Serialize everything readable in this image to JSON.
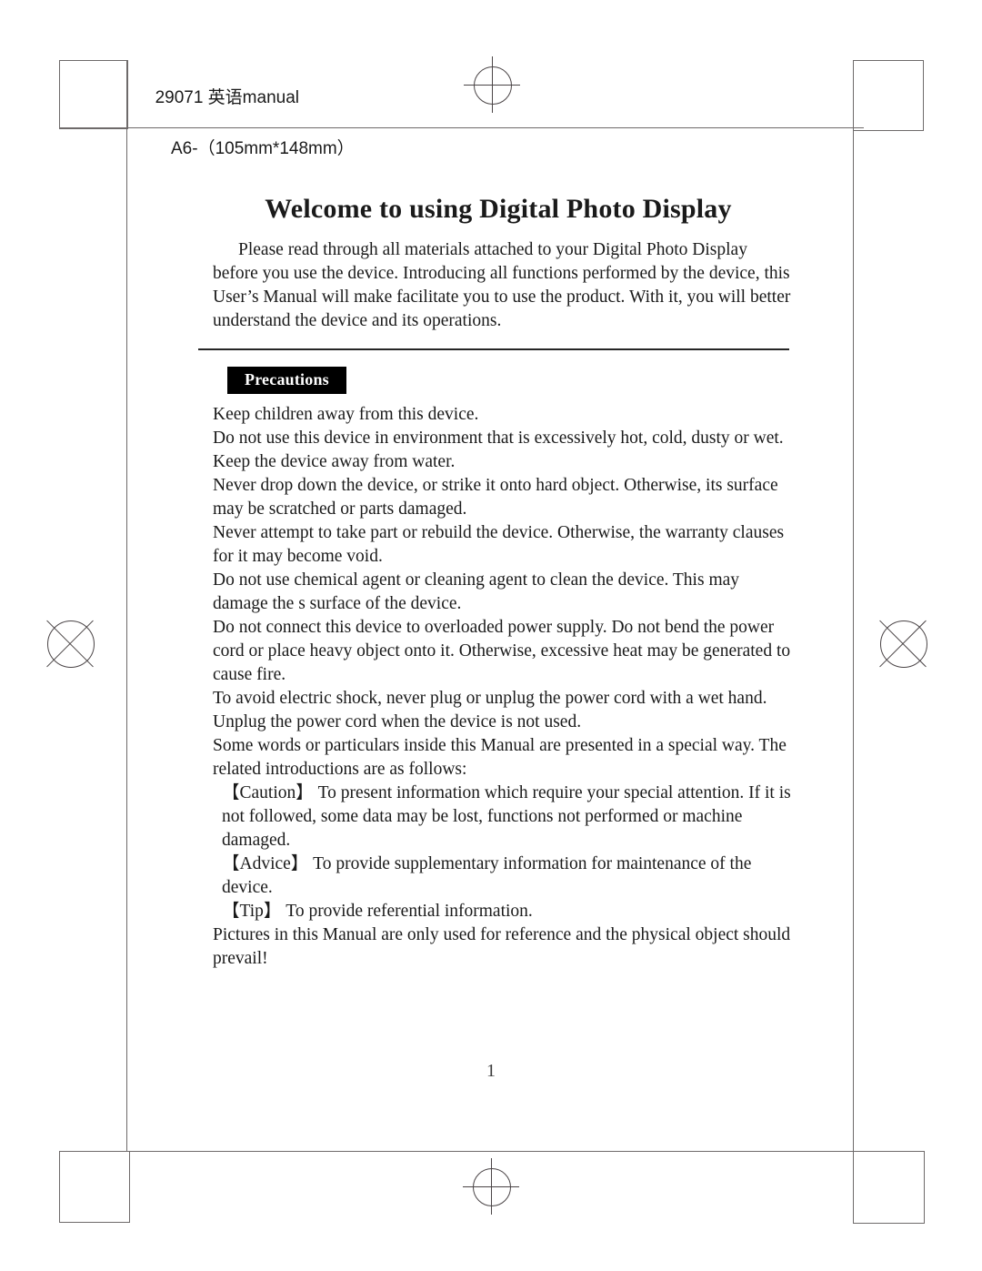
{
  "print_note": {
    "line1": "29071 英语manual",
    "line2": "A6-（105mm*148mm）"
  },
  "document": {
    "title": "Welcome to using Digital Photo Display",
    "intro": "Please read through all materials attached to your Digital Photo Display before you use the device. Introducing all functions performed by the device, this User’s Manual will make facilitate you to use the product. With it, you will better understand the device and its operations.",
    "section_tag": "Precautions",
    "precautions": [
      "Keep children away from this device.",
      "Do not use this device in environment that is excessively hot, cold, dusty or wet.",
      "Keep the device away from water.",
      "Never drop down the device, or strike it onto hard object. Otherwise, its surface may be scratched or parts damaged.",
      "Never attempt to take part or rebuild the device. Otherwise, the warranty clauses for it may become void.",
      "Do not use chemical agent or cleaning agent to clean the device. This may damage the s surface of the device.",
      "Do not connect this device to overloaded power supply. Do not bend the power cord or place heavy object onto it. Otherwise, excessive heat may be generated to cause fire.",
      "To avoid electric shock, never plug or unplug the power cord with a wet hand.",
      "Unplug the power cord when the device is not used.",
      "Some words or particulars inside this Manual are presented in a special way. The related introductions are as follows:",
      "【Caution】 To present information which require your special attention. If it is not followed, some data may be lost, functions not performed or machine damaged.",
      "【Advice】 To provide supplementary information for maintenance of the device.",
      "【Tip】 To provide referential information.",
      "Pictures in this Manual are only used for reference and the physical object should prevail!"
    ],
    "page_number": "1"
  }
}
